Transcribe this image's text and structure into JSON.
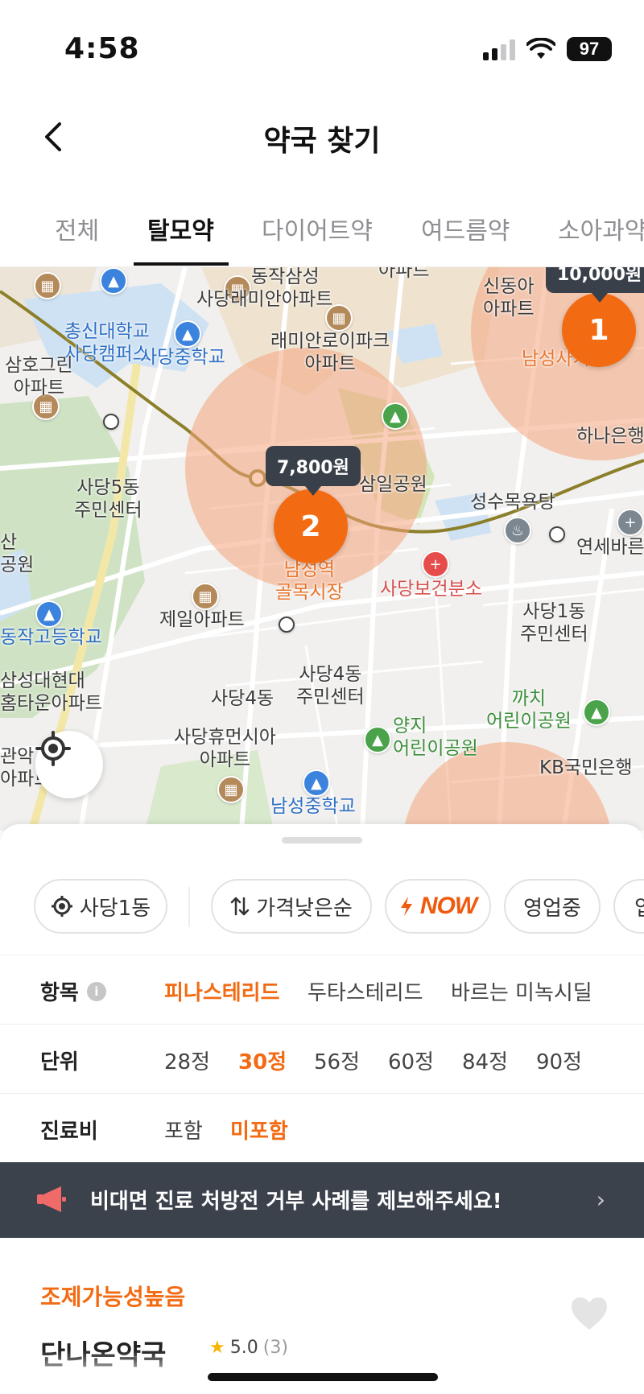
{
  "status_bar": {
    "time": "4:58",
    "battery": "97"
  },
  "header": {
    "title": "약국 찾기"
  },
  "tabs": [
    {
      "label": "전체"
    },
    {
      "label": "탈모약"
    },
    {
      "label": "다이어트약"
    },
    {
      "label": "여드름약"
    },
    {
      "label": "소아과약"
    }
  ],
  "active_tab": "탈모약",
  "map": {
    "labels": {
      "dongjak_samsung": "동작삼성",
      "sadang_raemian": "사당래미안아파트",
      "apartment_top": "아파트",
      "chongshin": "총신대학교\n사당캠퍼스",
      "sadang_middle": "사당중학교",
      "raemian_epark": "래미안로이파크\n아파트",
      "samho_green": "삼호그린\n아파트",
      "sadang5_center": "사당5동\n주민센터",
      "samil_park": "삼일공원",
      "seongsu_bath": "성수목욕탕",
      "yonsei": "연세바른",
      "sinil_apt": "신동아\n아파트",
      "namseong_market": "남성역\n골목시장",
      "sadang_health": "사당보건분소",
      "sadang1_center": "사당1동\n주민센터",
      "jeil_apt": "제일아파트",
      "dongjak_high": "동작고등학교",
      "samsung_hometown": "삼성대현대\n홈타운아파트",
      "sadang4_center": "사당4동\n주민센터",
      "sadang4_short": "사당4동",
      "yangji_park": "양지\n어린이공원",
      "kkachi_park": "까치\n어린이공원",
      "sadang_human": "사당휴먼시아\n아파트",
      "kb_bank": "KB국민은행",
      "namseong_middle": "남성중학교",
      "hana_bank": "하나은행",
      "san_park": "산\n공원",
      "gwanak": "관악\n아파트",
      "nam_fragment": "남",
      "namseong_fragment": "남성사거리"
    },
    "clusters": [
      {
        "count": "1",
        "price": "10,000원"
      },
      {
        "count": "2",
        "price": "7,800원"
      }
    ]
  },
  "chips": {
    "location": "사당1동",
    "sort": "가격낮은순",
    "now": "NOW",
    "open": "영업중",
    "more": "입"
  },
  "filters": {
    "item": {
      "label": "항목",
      "options": [
        "피나스테리드",
        "두타스테리드",
        "바르는 미녹시딜"
      ],
      "selected": "피나스테리드"
    },
    "unit": {
      "label": "단위",
      "options": [
        "28정",
        "30정",
        "56정",
        "60정",
        "84정",
        "90정"
      ],
      "selected": "30정"
    },
    "fee": {
      "label": "진료비",
      "options": [
        "포함",
        "미포함"
      ],
      "selected": "미포함"
    }
  },
  "banner": {
    "text": "비대면 진료 처방전 거부 사례를 제보해주세요!"
  },
  "result": {
    "badge": "조제가능성높음",
    "name": "단나온약국",
    "rating": "5.0",
    "reviews": "(3)"
  },
  "colors": {
    "accent": "#f26b13",
    "banner_bg": "#3b424c",
    "price_tag": "#3a4049"
  },
  "icons": [
    "back-chevron-icon",
    "location-target-icon",
    "sort-arrows-icon",
    "lightning-icon",
    "info-icon",
    "megaphone-icon",
    "chevron-right-icon",
    "heart-icon",
    "star-icon",
    "wifi-icon",
    "signal-icon",
    "battery-icon"
  ]
}
